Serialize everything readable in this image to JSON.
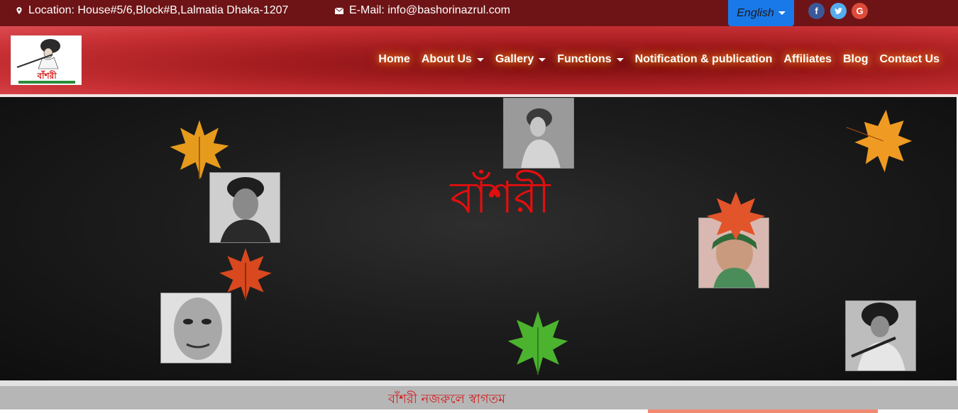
{
  "topbar": {
    "location": "Location: House#5/6,Block#B,Lalmatia Dhaka-1207",
    "email": "E-Mail: info@bashorinazrul.com",
    "language": "English",
    "social": [
      "f",
      "t",
      "G"
    ]
  },
  "logo": {
    "caption": "বাঁশরী"
  },
  "nav": {
    "items": [
      {
        "label": "Home",
        "dropdown": false
      },
      {
        "label": "About Us",
        "dropdown": true
      },
      {
        "label": "Gallery",
        "dropdown": true
      },
      {
        "label": "Functions",
        "dropdown": true
      },
      {
        "label": "Notification & publication",
        "dropdown": false
      },
      {
        "label": "Affiliates",
        "dropdown": false
      },
      {
        "label": "Blog",
        "dropdown": false
      },
      {
        "label": "Contact Us",
        "dropdown": false
      }
    ]
  },
  "hero": {
    "title": "বাঁশরী"
  },
  "welcome": {
    "text": "বাঁশরী নজরুলে স্বাগতম"
  },
  "colors": {
    "topbar": "#6e1416",
    "nav_glow": "#ff9a30",
    "title_red": "#e30e0e",
    "lang_button": "#1a79e8"
  }
}
